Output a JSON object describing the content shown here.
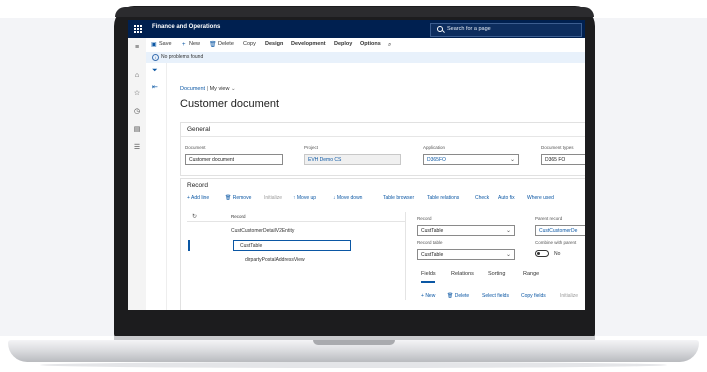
{
  "app": {
    "title": "Finance and Operations",
    "search_placeholder": "Search for a page"
  },
  "toolbar": {
    "save": "Save",
    "new": "New",
    "delete": "Delete",
    "copy": "Copy",
    "design": "Design",
    "development": "Development",
    "deploy": "Deploy",
    "options": "Options"
  },
  "message": "No problems found",
  "breadcrumb": {
    "root": "Document",
    "separator": "|",
    "view": "My view"
  },
  "page_title": "Customer document",
  "general": {
    "title": "General",
    "document_label": "Document",
    "document_value": "Customer document",
    "project_label": "Project",
    "project_value": "EVH Demo CS",
    "application_label": "Application",
    "application_value": "D365FO",
    "document_types_label": "Document types",
    "document_types_value": "D365 FO"
  },
  "record": {
    "title": "Record",
    "tools": {
      "add_line": "Add line",
      "remove": "Remove",
      "initialize": "Initialize",
      "move_up": "Move up",
      "move_down": "Move down",
      "table_browser": "Table browser",
      "table_relations": "Table relations",
      "check": "Check",
      "auto_fix": "Auto fix",
      "where_used": "Where used"
    },
    "tree_header": "Record",
    "tree_items": [
      "CustCustomerDetailV2Entity",
      "CustTable",
      "dirpartyPostalAddressView"
    ],
    "record_label": "Record",
    "record_value": "CustTable",
    "record_table_label": "Record table",
    "record_table_value": "CustTable",
    "parent_record_label": "Parent record",
    "parent_record_value": "CustCustomerDe",
    "combine_label": "Combine with parent",
    "combine_value": "No",
    "tabs": [
      "Fields",
      "Relations",
      "Sorting",
      "Range"
    ],
    "field_tools": {
      "new": "New",
      "delete": "Delete",
      "select_fields": "Select fields",
      "copy_fields": "Copy fields",
      "initialize": "Initialize"
    }
  },
  "colors": {
    "nav": "#002050",
    "accent": "#0b57a4"
  }
}
